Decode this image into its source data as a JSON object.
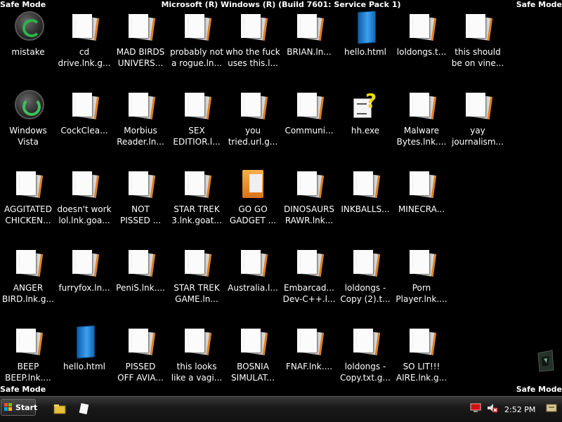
{
  "window": {
    "mode_text": "Safe Mode",
    "build_text": "Microsoft (R) Windows (R) (Build 7601: Service Pack 1)"
  },
  "desktop": {
    "icons": [
      {
        "label": "mistake",
        "icon": "green-orb-icon"
      },
      {
        "label": "cd\ndrive.lnk.g...",
        "icon": "document-icon"
      },
      {
        "label": "MAD BIRDS\nUNIVERS...",
        "icon": "document-icon"
      },
      {
        "label": "probably not\na rogue.ln...",
        "icon": "document-icon"
      },
      {
        "label": "who the fuck\nuses this.l...",
        "icon": "document-icon"
      },
      {
        "label": "BRIAN.ln...",
        "icon": "document-icon"
      },
      {
        "label": "hello.html",
        "icon": "html-file-icon"
      },
      {
        "label": "loldongs.t...",
        "icon": "document-icon"
      },
      {
        "label": "this should\nbe on vine...",
        "icon": "document-icon"
      },
      {
        "label": "Windows\nVista",
        "icon": "recycle-bin-icon"
      },
      {
        "label": "CockClea...",
        "icon": "document-icon"
      },
      {
        "label": "Morbius\nReader.ln...",
        "icon": "document-icon"
      },
      {
        "label": "SEX\nEDITIOR.l...",
        "icon": "document-icon"
      },
      {
        "label": "you\ntried.url.g...",
        "icon": "document-icon"
      },
      {
        "label": "Communi...",
        "icon": "document-icon"
      },
      {
        "label": "hh.exe",
        "icon": "help-exe-icon"
      },
      {
        "label": "Malware\nBytes.lnk....",
        "icon": "document-icon"
      },
      {
        "label": "yay\njournalism...",
        "icon": "document-icon"
      },
      {
        "label": "AGGITATED\nCHICKEN...",
        "icon": "document-icon"
      },
      {
        "label": "doesn't work\nlol.lnk.goa...",
        "icon": "document-icon"
      },
      {
        "label": "NOT\nPISSED ...",
        "icon": "document-icon"
      },
      {
        "label": "STAR TREK\n3.lnk.goat...",
        "icon": "document-icon"
      },
      {
        "label": "GO GO\nGADGET ...",
        "icon": "folder-icon"
      },
      {
        "label": "DINOSAURS\nRAWR.lnk...",
        "icon": "document-icon"
      },
      {
        "label": "INKBALLS...",
        "icon": "document-icon"
      },
      {
        "label": "MINECRA...",
        "icon": "document-icon"
      },
      {
        "label": "ANGER\nBIRD.lnk.g...",
        "icon": "document-icon"
      },
      {
        "label": "furryfox.ln...",
        "icon": "document-icon"
      },
      {
        "label": "PeniS.lnk....",
        "icon": "document-icon"
      },
      {
        "label": "STAR TREK\nGAME.ln...",
        "icon": "document-icon"
      },
      {
        "label": "Australia.l...",
        "icon": "document-icon"
      },
      {
        "label": "Embarcad...\nDev-C++.l...",
        "icon": "document-icon"
      },
      {
        "label": "loldongs -\nCopy (2).t...",
        "icon": "document-icon"
      },
      {
        "label": "Porn\nPlayer.lnk....",
        "icon": "document-icon"
      },
      {
        "label": "BEEP\nBEEP.lnk....",
        "icon": "document-icon"
      },
      {
        "label": "hello.html",
        "icon": "html-file-icon"
      },
      {
        "label": "PISSED\nOFF AVIA...",
        "icon": "document-icon"
      },
      {
        "label": "this looks\nlike a vagi...",
        "icon": "document-icon"
      },
      {
        "label": "BOSNIA\nSIMULAT...",
        "icon": "document-icon"
      },
      {
        "label": "FNAF.lnk....",
        "icon": "document-icon"
      },
      {
        "label": "loldongs -\nCopy.txt.g...",
        "icon": "document-icon"
      },
      {
        "label": "SO LIT!!!\nAIRE.lnk.g...",
        "icon": "document-icon"
      }
    ]
  },
  "taskbar": {
    "start_label": "Start",
    "clock": "2:52 PM",
    "quicklaunch": [
      "explorer-folder-icon",
      "document-icon"
    ],
    "tray": [
      "network-icon",
      "mute-speaker-icon",
      "action-center-icon"
    ]
  }
}
